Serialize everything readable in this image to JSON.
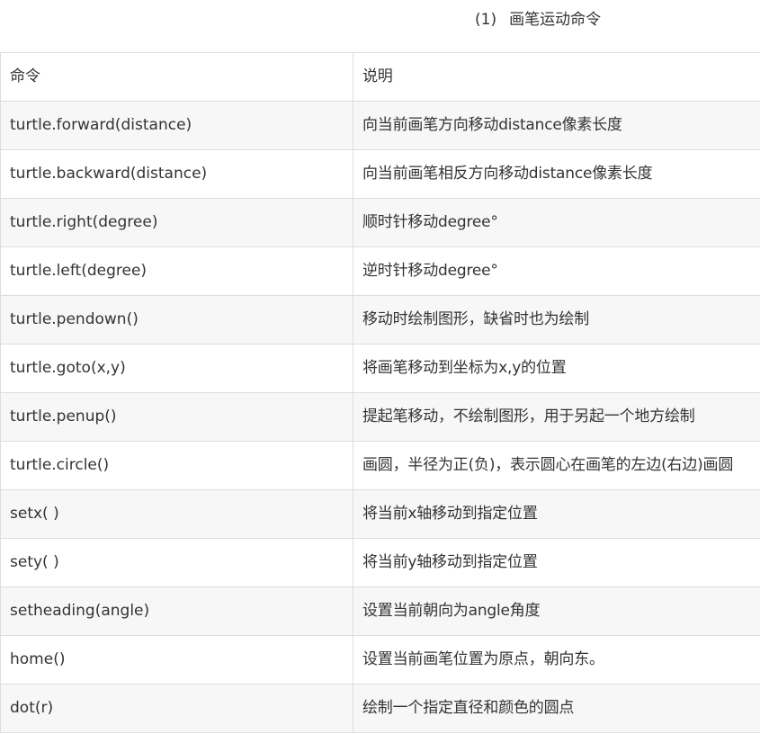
{
  "heading": {
    "number": "(1)",
    "title": "画笔运动命令"
  },
  "table": {
    "header": [
      "命令",
      "说明"
    ],
    "rows": [
      [
        "turtle.forward(distance)",
        "向当前画笔方向移动distance像素长度"
      ],
      [
        "turtle.backward(distance)",
        "向当前画笔相反方向移动distance像素长度"
      ],
      [
        "turtle.right(degree)",
        "顺时针移动degree°"
      ],
      [
        "turtle.left(degree)",
        "逆时针移动degree°"
      ],
      [
        "turtle.pendown()",
        "移动时绘制图形，缺省时也为绘制"
      ],
      [
        "turtle.goto(x,y)",
        "将画笔移动到坐标为x,y的位置"
      ],
      [
        "turtle.penup()",
        "提起笔移动，不绘制图形，用于另起一个地方绘制"
      ],
      [
        "turtle.circle()",
        "画圆，半径为正(负)，表示圆心在画笔的左边(右边)画圆"
      ],
      [
        "setx( )",
        "将当前x轴移动到指定位置"
      ],
      [
        "sety( )",
        "将当前y轴移动到指定位置"
      ],
      [
        "setheading(angle)",
        "设置当前朝向为angle角度"
      ],
      [
        "home()",
        "设置当前画笔位置为原点，朝向东。"
      ],
      [
        "dot(r)",
        "绘制一个指定直径和颜色的圆点"
      ]
    ]
  }
}
